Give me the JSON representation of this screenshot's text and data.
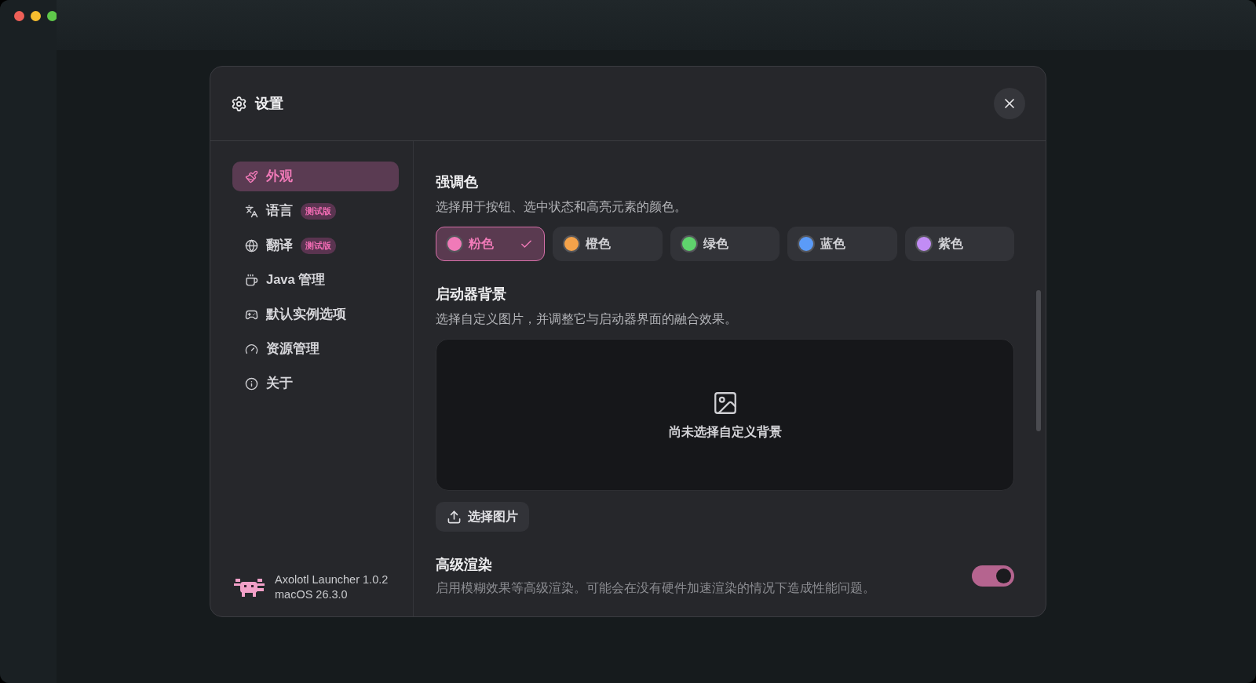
{
  "dialog": {
    "title": "设置"
  },
  "sidebar": {
    "items": [
      {
        "label": "外观",
        "selected": true
      },
      {
        "label": "语言",
        "selected": false,
        "badge": "测试版"
      },
      {
        "label": "翻译",
        "selected": false,
        "badge": "测试版"
      },
      {
        "label": "Java 管理",
        "selected": false
      },
      {
        "label": "默认实例选项",
        "selected": false
      },
      {
        "label": "资源管理",
        "selected": false
      },
      {
        "label": "关于",
        "selected": false
      }
    ],
    "footer": {
      "app": "Axolotl Launcher 1.0.2",
      "os": "macOS 26.3.0"
    }
  },
  "accent": {
    "title": "强调色",
    "description": "选择用于按钮、选中状态和高亮元素的颜色。",
    "colors": [
      {
        "label": "粉色",
        "color": "#f07ab8",
        "selected": true
      },
      {
        "label": "橙色",
        "color": "#f4a24a",
        "selected": false
      },
      {
        "label": "绿色",
        "color": "#5fd36d",
        "selected": false
      },
      {
        "label": "蓝色",
        "color": "#5b9bf8",
        "selected": false
      },
      {
        "label": "紫色",
        "color": "#c28cf5",
        "selected": false
      }
    ]
  },
  "background": {
    "title": "启动器背景",
    "description": "选择自定义图片，并调整它与启动器界面的融合效果。",
    "empty_text": "尚未选择自定义背景",
    "button": "选择图片"
  },
  "advanced": {
    "title": "高级渲染",
    "description": "启用模糊效果等高级渲染。可能会在没有硬件加速渲染的情况下造成性能问题。",
    "on": true
  }
}
